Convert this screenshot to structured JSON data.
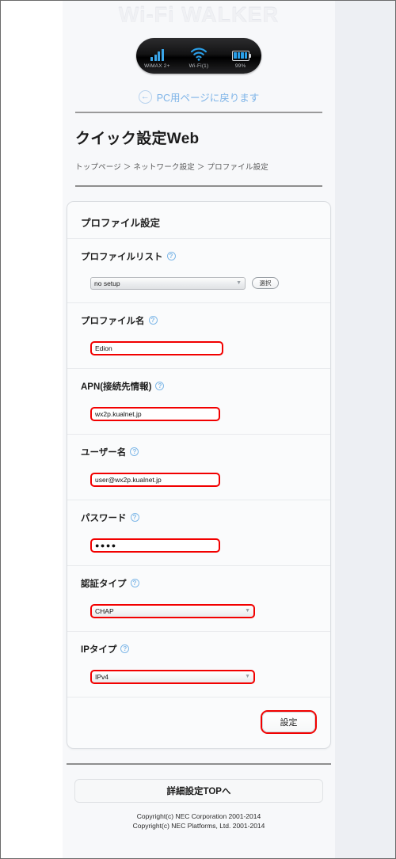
{
  "device": {
    "brand": "Wi-Fi WALKER",
    "status": [
      {
        "icon": "signal-bars-icon",
        "label": "WiMAX 2+"
      },
      {
        "icon": "wifi-icon",
        "label": "Wi-Fi(1)"
      },
      {
        "icon": "battery-icon",
        "label": "99%"
      }
    ],
    "pc_link": "PC用ページに戻ります",
    "pc_link_icon": "arrow-left-circle-icon"
  },
  "header": {
    "title": "クイック設定Web",
    "breadcrumb": "トップページ ＞ ネットワーク設定 ＞ プロファイル設定"
  },
  "card": {
    "heading": "プロファイル設定",
    "help_icon": "help-circle-icon",
    "chevron_icon": "chevron-down-icon",
    "profile_list": {
      "label": "プロファイルリスト",
      "value": "no setup",
      "button": "選択"
    },
    "fields": [
      {
        "label": "プロファイル名",
        "value": "Edion",
        "type": "text"
      },
      {
        "label": "APN(接続先情報)",
        "value": "wx2p.kualnet.jp",
        "type": "text"
      },
      {
        "label": "ユーザー名",
        "value": "user@wx2p.kualnet.jp",
        "type": "text"
      },
      {
        "label": "パスワード",
        "value": "●●●●",
        "type": "password"
      },
      {
        "label": "認証タイプ",
        "value": "CHAP",
        "type": "select"
      },
      {
        "label": "IPタイプ",
        "value": "IPv4",
        "type": "select"
      }
    ],
    "submit": "設定"
  },
  "footer": {
    "top_button": "詳細設定TOPへ",
    "copyright_1": "Copyright(c) NEC Corporation 2001-2014",
    "copyright_2": "Copyright(c) NEC Platforms, Ltd. 2001-2014"
  },
  "colors": {
    "highlight": "#f20000",
    "accent_blue": "#7fb8e8",
    "device_blue": "#2a9fe8"
  }
}
